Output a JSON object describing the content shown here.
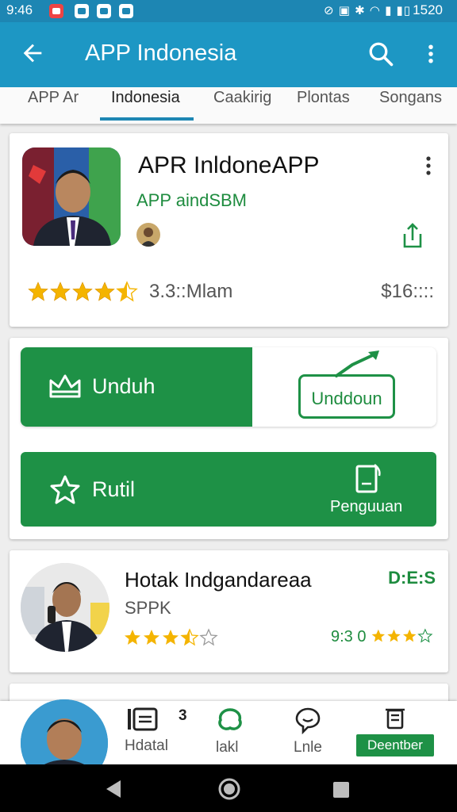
{
  "status_bar": {
    "time": "9:46",
    "right_time": "1520",
    "system_icons": "⊘ ▣ ✱ ◠ ▮ ▮▯"
  },
  "app_bar": {
    "title": "APP Indonesia"
  },
  "tabs": [
    {
      "label": "APP Ar"
    },
    {
      "label": "Indonesia",
      "active": true
    },
    {
      "label": "Caakirig"
    },
    {
      "label": "Plontas"
    },
    {
      "label": "Songans"
    }
  ],
  "app_card": {
    "name": "APR InldoneAPP",
    "developer": "APP aindSBM",
    "rating_stars": 4.5,
    "rating_text": "3.3::Mlam",
    "price": "$16::::"
  },
  "download_card": {
    "unduh_label": "Unduh",
    "unduh_outline_label": "Unddoun",
    "second_label": "Rutil",
    "second_sub_label": "Penguuan"
  },
  "recommendation": {
    "title": "Hotak Indgandareaa",
    "subtitle": "SPPK",
    "badge": "D:E:S",
    "stars": 3.5,
    "right_text": "9:3 0",
    "right_stars": 3.5
  },
  "bottom_nav": [
    {
      "label": "Hdatal",
      "badge": "3"
    },
    {
      "label": "lakl"
    },
    {
      "label": "Lnle"
    },
    {
      "label": "Deentber"
    }
  ],
  "colors": {
    "app_bar": "#1d97c4",
    "accent_green": "#1e9146",
    "star": "#f4b400"
  }
}
